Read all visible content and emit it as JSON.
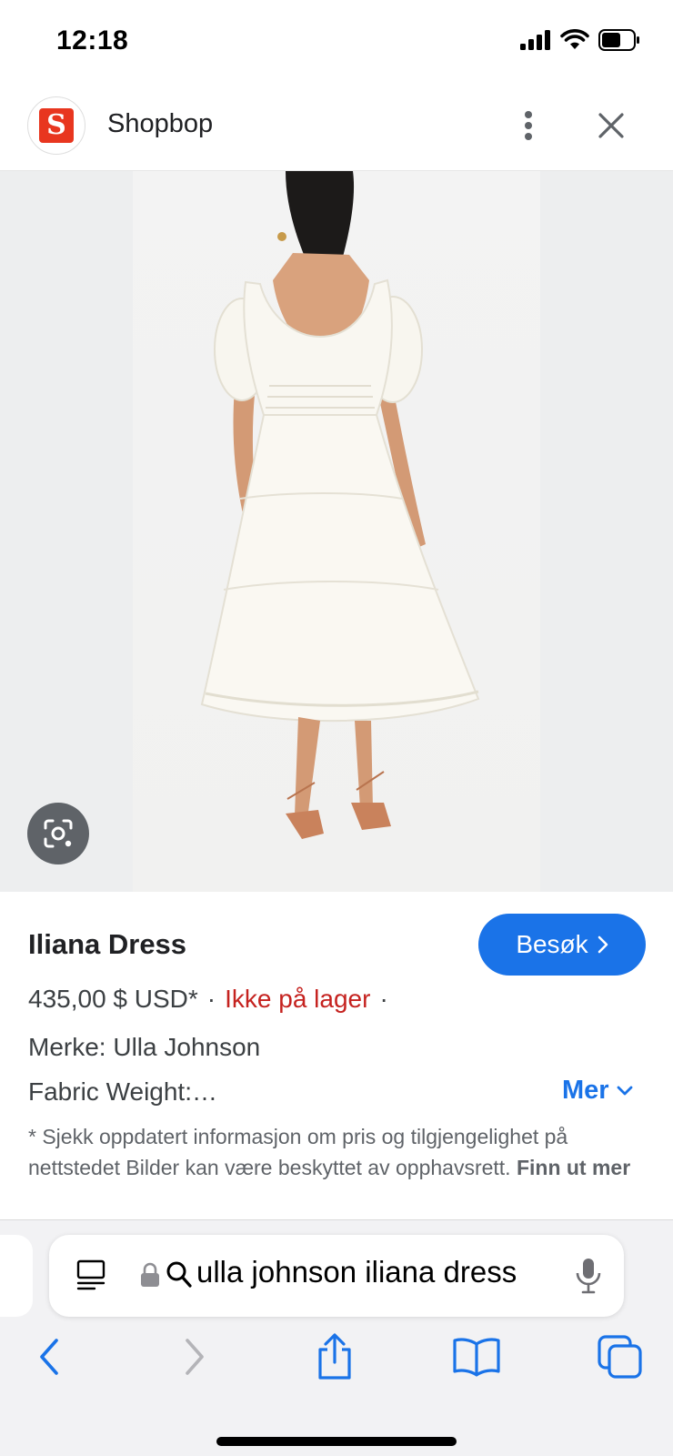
{
  "status_bar": {
    "time": "12:18"
  },
  "header": {
    "site_initial": "S",
    "site_name": "Shopbop"
  },
  "product": {
    "title": "Iliana Dress",
    "visit_label": "Besøk",
    "price": "435,00 $ USD*",
    "stock_status": "Ikke på lager",
    "brand": "Merke: Ulla Johnson",
    "fabric": "Fabric Weight:…",
    "more_label": "Mer",
    "disclaimer": "* Sjekk oppdatert informasjon om pris og tilgjengelighet på nettstedet Bilder kan være beskyttet av opphavsrett.",
    "learn_more": "Finn ut mer"
  },
  "browser": {
    "url_text": "ulla johnson iliana dress"
  },
  "icons": [
    "signal-icon",
    "wifi-icon",
    "battery-icon",
    "more-vert-icon",
    "close-icon",
    "lens-icon",
    "chevron-right-icon",
    "chevron-down-icon",
    "reader-icon",
    "lock-icon",
    "search-icon",
    "mic-icon",
    "back-icon",
    "forward-icon",
    "share-icon",
    "bookmarks-icon",
    "tabs-icon"
  ],
  "colors": {
    "accent": "#1a73e8",
    "stock_out": "#c5221f",
    "brand_logo": "#e8361f"
  }
}
